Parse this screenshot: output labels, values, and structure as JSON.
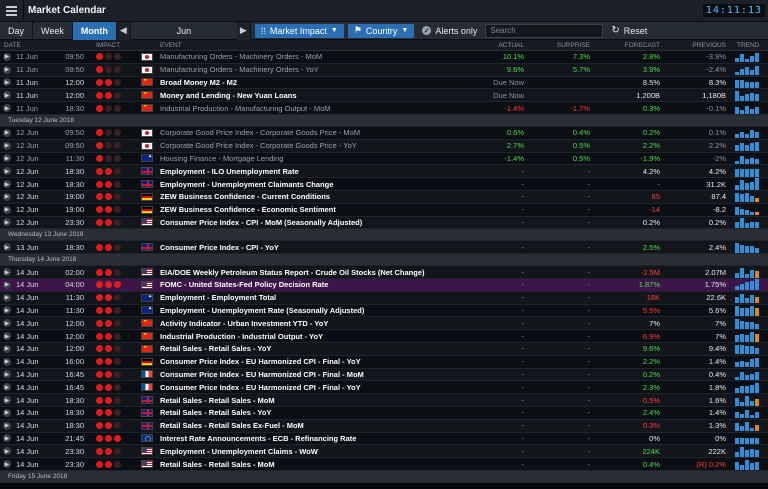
{
  "app": {
    "title": "Market Calendar",
    "clock": "14:11:13"
  },
  "toolbar": {
    "day": "Day",
    "week": "Week",
    "month": "Month",
    "prev": "◀",
    "next": "▶",
    "month_label": "Jun",
    "impact": "Market Impact",
    "country": "Country",
    "alerts": "Alerts only",
    "search_placeholder": "Search",
    "reset": "Reset"
  },
  "columns": {
    "date": "DATE",
    "impact": "IMPACT",
    "event": "EVENT",
    "actual": "ACTUAL",
    "surprise": "SURPRISE",
    "forecast": "FORECAST",
    "previous": "PREVIOUS",
    "trend": "TREND"
  },
  "colors": {
    "accent": "#2a6fb3",
    "positive": "#4fdc4f",
    "negative": "#ff3b3b",
    "impact_on": "#e01d1d",
    "highlight_row": "#3d1548"
  },
  "rows": [
    {
      "date": "11 Jun",
      "time": "09:50",
      "impact": 1,
      "flag": "jp",
      "event": "Manufacturing Orders - Machinery Orders - MoM",
      "actual": "10.1%",
      "ac": "g",
      "surprise": "7.3%",
      "sc": "g",
      "forecast": "2.8%",
      "fcc": "g",
      "previous": "-3.9%",
      "pc": "gr",
      "style": "dim",
      "trend": [
        3,
        5,
        2,
        4,
        6
      ]
    },
    {
      "date": "11 Jun",
      "time": "09:50",
      "impact": 1,
      "flag": "jp",
      "event": "Manufacturing Orders - Machinery Orders - YoY",
      "actual": "9.6%",
      "ac": "g",
      "surprise": "5.7%",
      "sc": "g",
      "forecast": "3.9%",
      "fcc": "g",
      "previous": "-2.4%",
      "pc": "gr",
      "style": "dim",
      "trend": [
        2,
        4,
        5,
        3,
        6
      ]
    },
    {
      "date": "11 Jun",
      "time": "12:00",
      "impact": 2,
      "flag": "cn",
      "event": "Broad Money M2 - M2",
      "actual": "Due Now",
      "ac": "gr",
      "surprise": "",
      "sc": "w",
      "forecast": "8.5%",
      "fcc": "w",
      "previous": "8.3%",
      "pc": "w",
      "style": "bold",
      "trend": [
        5,
        5,
        4,
        4,
        4
      ]
    },
    {
      "date": "11 Jun",
      "time": "12:00",
      "impact": 2,
      "flag": "cn",
      "event": "Money and Lending - New Yuan Loans",
      "actual": "Due Now",
      "ac": "gr",
      "surprise": "",
      "sc": "w",
      "forecast": "1,200B",
      "fcc": "w",
      "previous": "1,180B",
      "pc": "w",
      "style": "bold",
      "trend": [
        6,
        3,
        4,
        5,
        4
      ]
    },
    {
      "date": "11 Jun",
      "time": "18:30",
      "impact": 1,
      "flag": "cn",
      "event": "Industrial Production - Manufacturing Output - MoM",
      "actual": "-1.4%",
      "ac": "r",
      "surprise": "-1.7%",
      "sc": "r",
      "forecast": "0.3%",
      "fcc": "g",
      "previous": "-0.1%",
      "pc": "gr",
      "style": "dim",
      "trend": [
        4,
        2,
        5,
        3,
        4
      ]
    },
    {
      "sep": "Tuesday 12 June 2018"
    },
    {
      "date": "12 Jun",
      "time": "09:50",
      "impact": 1,
      "flag": "jp",
      "event": "Corporate Good Price Index - Corporate Goods Price - MoM",
      "actual": "0.6%",
      "ac": "g",
      "surprise": "0.4%",
      "sc": "g",
      "forecast": "0.2%",
      "fcc": "g",
      "previous": "0.1%",
      "pc": "gr",
      "style": "dim",
      "trend": [
        3,
        4,
        3,
        5,
        4
      ]
    },
    {
      "date": "12 Jun",
      "time": "09:50",
      "impact": 1,
      "flag": "jp",
      "event": "Corporate Good Price Index - Corporate Goods Price - YoY",
      "actual": "2.7%",
      "ac": "g",
      "surprise": "0.5%",
      "sc": "g",
      "forecast": "2.2%",
      "fcc": "g",
      "previous": "2.2%",
      "pc": "gr",
      "style": "dim",
      "trend": [
        4,
        5,
        4,
        5,
        6
      ]
    },
    {
      "date": "12 Jun",
      "time": "11:30",
      "impact": 1,
      "flag": "au",
      "event": "Housing Finance - Mortgage Lending",
      "actual": "-1.4%",
      "ac": "g",
      "surprise": "0.5%",
      "sc": "g",
      "forecast": "-1.9%",
      "fcc": "g",
      "previous": "-2%",
      "pc": "gr",
      "style": "dim",
      "trend": [
        2,
        5,
        3,
        4,
        3
      ]
    },
    {
      "date": "12 Jun",
      "time": "18:30",
      "impact": 2,
      "flag": "gb",
      "event": "Employment - ILO Unemployment Rate",
      "actual": "-",
      "ac": "gr",
      "surprise": "-",
      "sc": "gr",
      "forecast": "4.2%",
      "fcc": "w",
      "previous": "4.2%",
      "pc": "w",
      "style": "bold",
      "trend": [
        5,
        5,
        5,
        5,
        5
      ]
    },
    {
      "date": "12 Jun",
      "time": "18:30",
      "impact": 2,
      "flag": "gb",
      "event": "Employment - Unemployment Claimants Change",
      "actual": "-",
      "ac": "gr",
      "surprise": "-",
      "sc": "gr",
      "forecast": "-",
      "fcc": "gr",
      "previous": "31.2K",
      "pc": "w",
      "style": "bold",
      "trend": [
        3,
        6,
        4,
        5,
        7
      ]
    },
    {
      "date": "12 Jun",
      "time": "19:00",
      "impact": 2,
      "flag": "de",
      "event": "ZEW Business Confidence - Current Conditions",
      "actual": "-",
      "ac": "gr",
      "surprise": "-",
      "sc": "gr",
      "forecast": "85",
      "fcc": "r",
      "previous": "87.4",
      "pc": "w",
      "style": "bold",
      "trend": [
        6,
        5,
        6,
        4,
        3
      ]
    },
    {
      "date": "12 Jun",
      "time": "19:00",
      "impact": 2,
      "flag": "de",
      "event": "ZEW Business Confidence - Economic Sentiment",
      "actual": "-",
      "ac": "gr",
      "surprise": "-",
      "sc": "gr",
      "forecast": "-14",
      "fcc": "r",
      "previous": "-8.2",
      "pc": "w",
      "style": "bold",
      "trend": [
        5,
        4,
        3,
        2,
        2
      ]
    },
    {
      "date": "12 Jun",
      "time": "23:30",
      "impact": 2,
      "flag": "us",
      "event": "Consumer Price Index - CPI - MoM (Seasonally Adjusted)",
      "actual": "-",
      "ac": "gr",
      "surprise": "-",
      "sc": "gr",
      "forecast": "0.2%",
      "fcc": "w",
      "previous": "0.2%",
      "pc": "w",
      "style": "bold",
      "trend": [
        4,
        6,
        3,
        4,
        4
      ]
    },
    {
      "sep": "Wednesday 13 June 2018"
    },
    {
      "date": "13 Jun",
      "time": "18:30",
      "impact": 2,
      "flag": "gb",
      "event": "Consumer Price Index - CPI - YoY",
      "actual": "-",
      "ac": "gr",
      "surprise": "-",
      "sc": "gr",
      "forecast": "2.5%",
      "fcc": "g",
      "previous": "2.4%",
      "pc": "w",
      "style": "bold",
      "trend": [
        6,
        5,
        4,
        4,
        3
      ]
    },
    {
      "sep": "Thursday 14 June 2018"
    },
    {
      "date": "14 Jun",
      "time": "02:00",
      "impact": 2,
      "flag": "us",
      "event": "EIA/DOE Weekly Petroleum Status Report - Crude Oil Stocks (Net Change)",
      "actual": "-",
      "ac": "gr",
      "surprise": "-",
      "sc": "gr",
      "forecast": "-2.5M",
      "fcc": "r",
      "previous": "2.07M",
      "pc": "w",
      "style": "bold",
      "trend": [
        3,
        6,
        2,
        5,
        4
      ]
    },
    {
      "date": "14 Jun",
      "time": "04:00",
      "impact": 3,
      "flag": "us",
      "event": "FOMC - United States-Fed Policy Decision Rate",
      "actual": "-",
      "ac": "gr",
      "surprise": "-",
      "sc": "gr",
      "forecast": "1.87%",
      "fcc": "g",
      "previous": "1.75%",
      "pc": "w",
      "style": "hl",
      "trend": [
        3,
        4,
        5,
        6,
        7
      ]
    },
    {
      "date": "14 Jun",
      "time": "11:30",
      "impact": 2,
      "flag": "au",
      "event": "Employment - Employment Total",
      "actual": "-",
      "ac": "gr",
      "surprise": "-",
      "sc": "gr",
      "forecast": "18K",
      "fcc": "r",
      "previous": "22.6K",
      "pc": "w",
      "style": "bold",
      "trend": [
        4,
        6,
        3,
        5,
        4
      ]
    },
    {
      "date": "14 Jun",
      "time": "11:30",
      "impact": 2,
      "flag": "au",
      "event": "Employment - Unemployment Rate (Seasonally Adjusted)",
      "actual": "-",
      "ac": "gr",
      "surprise": "-",
      "sc": "gr",
      "forecast": "5.5%",
      "fcc": "r",
      "previous": "5.6%",
      "pc": "w",
      "style": "bold",
      "trend": [
        6,
        5,
        5,
        6,
        5
      ]
    },
    {
      "date": "14 Jun",
      "time": "12:00",
      "impact": 2,
      "flag": "cn",
      "event": "Activity Indicator - Urban Investment YTD - YoY",
      "actual": "-",
      "ac": "gr",
      "surprise": "-",
      "sc": "gr",
      "forecast": "7%",
      "fcc": "w",
      "previous": "7%",
      "pc": "w",
      "style": "bold",
      "trend": [
        6,
        5,
        4,
        4,
        3
      ]
    },
    {
      "date": "14 Jun",
      "time": "12:00",
      "impact": 2,
      "flag": "cn",
      "event": "Industrial Production - Industrial Output - YoY",
      "actual": "-",
      "ac": "gr",
      "surprise": "-",
      "sc": "gr",
      "forecast": "6.9%",
      "fcc": "r",
      "previous": "7%",
      "pc": "w",
      "style": "bold",
      "trend": [
        4,
        5,
        4,
        6,
        5
      ]
    },
    {
      "date": "14 Jun",
      "time": "12:00",
      "impact": 2,
      "flag": "cn",
      "event": "Retail Sales - Retail Sales - YoY",
      "actual": "-",
      "ac": "gr",
      "surprise": "-",
      "sc": "gr",
      "forecast": "9.6%",
      "fcc": "g",
      "previous": "9.4%",
      "pc": "w",
      "style": "bold",
      "trend": [
        6,
        6,
        5,
        5,
        4
      ]
    },
    {
      "date": "14 Jun",
      "time": "16:00",
      "impact": 2,
      "flag": "de",
      "event": "Consumer Price Index - EU Harmonized CPI - Final - YoY",
      "actual": "-",
      "ac": "gr",
      "surprise": "-",
      "sc": "gr",
      "forecast": "2.2%",
      "fcc": "g",
      "previous": "1.4%",
      "pc": "w",
      "style": "bold",
      "trend": [
        3,
        4,
        3,
        5,
        6
      ]
    },
    {
      "date": "14 Jun",
      "time": "16:45",
      "impact": 2,
      "flag": "fr",
      "event": "Consumer Price Index - EU Harmonized CPI - Final - MoM",
      "actual": "-",
      "ac": "gr",
      "surprise": "-",
      "sc": "gr",
      "forecast": "0.2%",
      "fcc": "g",
      "previous": "0.4%",
      "pc": "w",
      "style": "bold",
      "trend": [
        2,
        5,
        3,
        4,
        5
      ]
    },
    {
      "date": "14 Jun",
      "time": "16:45",
      "impact": 2,
      "flag": "fr",
      "event": "Consumer Price Index - EU Harmonized CPI - Final - YoY",
      "actual": "-",
      "ac": "gr",
      "surprise": "-",
      "sc": "gr",
      "forecast": "2.3%",
      "fcc": "g",
      "previous": "1.8%",
      "pc": "w",
      "style": "bold",
      "trend": [
        3,
        4,
        4,
        5,
        6
      ]
    },
    {
      "date": "14 Jun",
      "time": "18:30",
      "impact": 2,
      "flag": "gb",
      "event": "Retail Sales - Retail Sales - MoM",
      "actual": "-",
      "ac": "gr",
      "surprise": "-",
      "sc": "gr",
      "forecast": "0.5%",
      "fcc": "r",
      "previous": "1.6%",
      "pc": "w",
      "style": "bold",
      "trend": [
        5,
        2,
        6,
        3,
        4
      ]
    },
    {
      "date": "14 Jun",
      "time": "18:30",
      "impact": 2,
      "flag": "gb",
      "event": "Retail Sales - Retail Sales - YoY",
      "actual": "-",
      "ac": "gr",
      "surprise": "-",
      "sc": "gr",
      "forecast": "2.4%",
      "fcc": "g",
      "previous": "1.4%",
      "pc": "w",
      "style": "bold",
      "trend": [
        4,
        3,
        5,
        2,
        4
      ]
    },
    {
      "date": "14 Jun",
      "time": "18:30",
      "impact": 2,
      "flag": "gb",
      "event": "Retail Sales - Retail Sales Ex-Fuel - MoM",
      "actual": "-",
      "ac": "gr",
      "surprise": "-",
      "sc": "gr",
      "forecast": "0.3%",
      "fcc": "r",
      "previous": "1.3%",
      "pc": "w",
      "style": "bold",
      "trend": [
        5,
        3,
        6,
        2,
        4
      ]
    },
    {
      "date": "14 Jun",
      "time": "21:45",
      "impact": 3,
      "flag": "eu",
      "event": "Interest Rate Announcements - ECB - Refinancing Rate",
      "actual": "-",
      "ac": "gr",
      "surprise": "-",
      "sc": "gr",
      "forecast": "0%",
      "fcc": "w",
      "previous": "0%",
      "pc": "w",
      "style": "bold",
      "trend": [
        4,
        4,
        4,
        4,
        4
      ]
    },
    {
      "date": "14 Jun",
      "time": "23:30",
      "impact": 2,
      "flag": "us",
      "event": "Employment - Unemployment Claims - WoW",
      "actual": "-",
      "ac": "gr",
      "surprise": "-",
      "sc": "gr",
      "forecast": "224K",
      "fcc": "g",
      "previous": "222K",
      "pc": "w",
      "style": "bold",
      "trend": [
        3,
        6,
        4,
        5,
        4
      ]
    },
    {
      "date": "14 Jun",
      "time": "23:30",
      "impact": 2,
      "flag": "us",
      "event": "Retail Sales - Retail Sales - MoM",
      "actual": "-",
      "ac": "gr",
      "surprise": "-",
      "sc": "gr",
      "forecast": "0.4%",
      "fcc": "g",
      "previous": "(R) 0.2%",
      "pc": "r",
      "style": "bold",
      "trend": [
        5,
        3,
        6,
        4,
        5
      ]
    },
    {
      "sep": "Friday 15 June 2018"
    }
  ]
}
